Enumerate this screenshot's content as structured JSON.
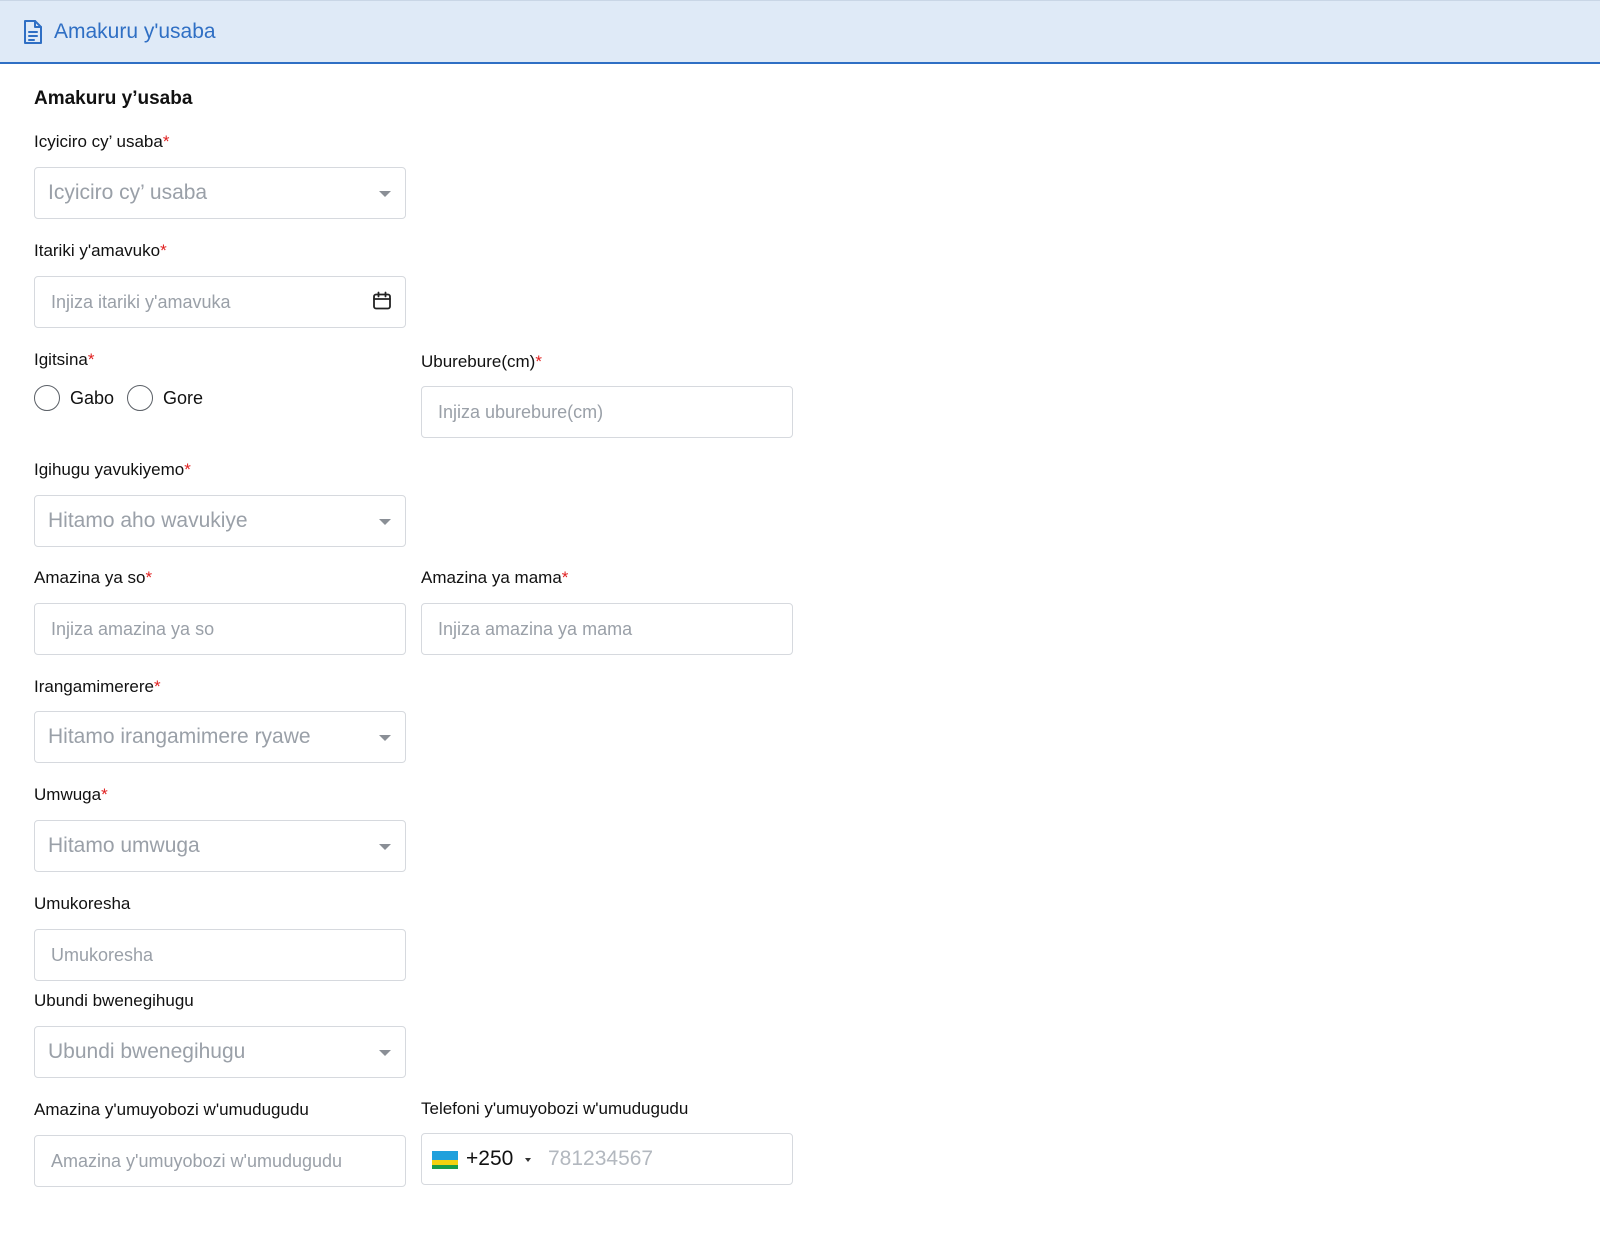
{
  "header": {
    "title": "Amakuru y'usaba",
    "icon": "document-icon"
  },
  "section_title": "Amakuru y’usaba",
  "fields": {
    "category": {
      "label": "Icyiciro cy’ usaba",
      "required": "*",
      "placeholder": "Icyiciro cy’ usaba"
    },
    "birthdate": {
      "label": "Itariki y'amavuko",
      "required": "*",
      "placeholder": "Injiza itariki y'amavuka",
      "icon": "calendar-icon"
    },
    "gender": {
      "label": "Igitsina",
      "required": "*",
      "options": [
        "Gabo",
        "Gore"
      ],
      "selected": null
    },
    "height": {
      "label": "Uburebure(cm)",
      "required": "*",
      "placeholder": "Injiza uburebure(cm)"
    },
    "birth_country": {
      "label": "Igihugu yavukiyemo",
      "required": "*",
      "placeholder": "Hitamo aho wavukiye"
    },
    "father_name": {
      "label": "Amazina ya so",
      "required": "*",
      "placeholder": "Injiza amazina ya so"
    },
    "mother_name": {
      "label": "Amazina ya mama",
      "required": "*",
      "placeholder": "Injiza amazina ya mama"
    },
    "marital_status": {
      "label": "Irangamimerere",
      "required": "*",
      "placeholder": "Hitamo irangamimere ryawe"
    },
    "occupation": {
      "label": "Umwuga",
      "required": "*",
      "placeholder": "Hitamo umwuga"
    },
    "employer": {
      "label": "Umukoresha",
      "placeholder": "Umukoresha"
    },
    "other_nationality": {
      "label": "Ubundi bwenegihugu",
      "placeholder": "Ubundi bwenegihugu"
    },
    "village_leader_name": {
      "label": "Amazina y'umuyobozi w'umudugudu",
      "placeholder": "Amazina y'umuyobozi w'umudugudu"
    },
    "village_leader_phone": {
      "label": "Telefoni y'umuyobozi w'umudugudu",
      "country_code": "+250",
      "placeholder": "781234567",
      "flag": "rwanda-flag"
    }
  },
  "colors": {
    "accent": "#2f6fc4",
    "header_bg": "#dfeaf7",
    "required": "#e02020",
    "placeholder": "#9aa0a8"
  }
}
